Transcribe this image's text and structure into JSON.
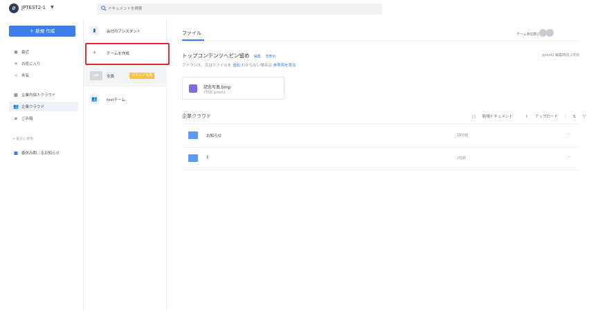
{
  "topbar": {
    "workspace_name": "JPTEST2-1",
    "search_placeholder": "ドキュメントを検索"
  },
  "nav": {
    "new_button": "新規 作成",
    "items": [
      {
        "label": "最近",
        "icon": "clock-icon"
      },
      {
        "label": "お気に入り",
        "icon": "star-icon"
      },
      {
        "label": "共有",
        "icon": "share-icon"
      },
      {
        "label": "企業内個人クラウド",
        "icon": "personal-cloud-icon"
      },
      {
        "label": "企業クラウド",
        "icon": "team-cloud-icon"
      },
      {
        "label": "ごみ箱",
        "icon": "trash-icon"
      }
    ],
    "recent_section": "最近に使用",
    "recent_doc": "春休み期…るお知らせ"
  },
  "teams": {
    "assistant": "会社のアシスタント",
    "create_team": "チームを作成",
    "all_staff": "全員",
    "staff_badge": "スタッフ全員",
    "test_team": "testチーム"
  },
  "main": {
    "tab_files": "ファイル",
    "members_label": "チーム参加数2",
    "top_title": "トップコンテンツへピン留め",
    "edit_link": "編集",
    "hide_link": "非表示",
    "top_meta": "jptest2 編集時間 2日前",
    "announce_prefix": "アナウンス、又はファイルを",
    "announce_add": "追加",
    "announce_mid": "わからない場合は",
    "announce_example": "参考例を見る",
    "pinned_file": {
      "name": "記念写真.bmp",
      "meta": "7日前 jptest1"
    },
    "section_title": "企業クラウド",
    "new_doc": "新規ドキュメント",
    "upload": "アップロード",
    "rows": [
      {
        "name": "お知らせ",
        "time": "18分前",
        "more": "···"
      },
      {
        "name": "1",
        "time": "2日前",
        "more": "···"
      }
    ]
  },
  "colors": {
    "accent": "#3b7de9",
    "highlight": "#e8262a",
    "badge": "#f6c244"
  }
}
